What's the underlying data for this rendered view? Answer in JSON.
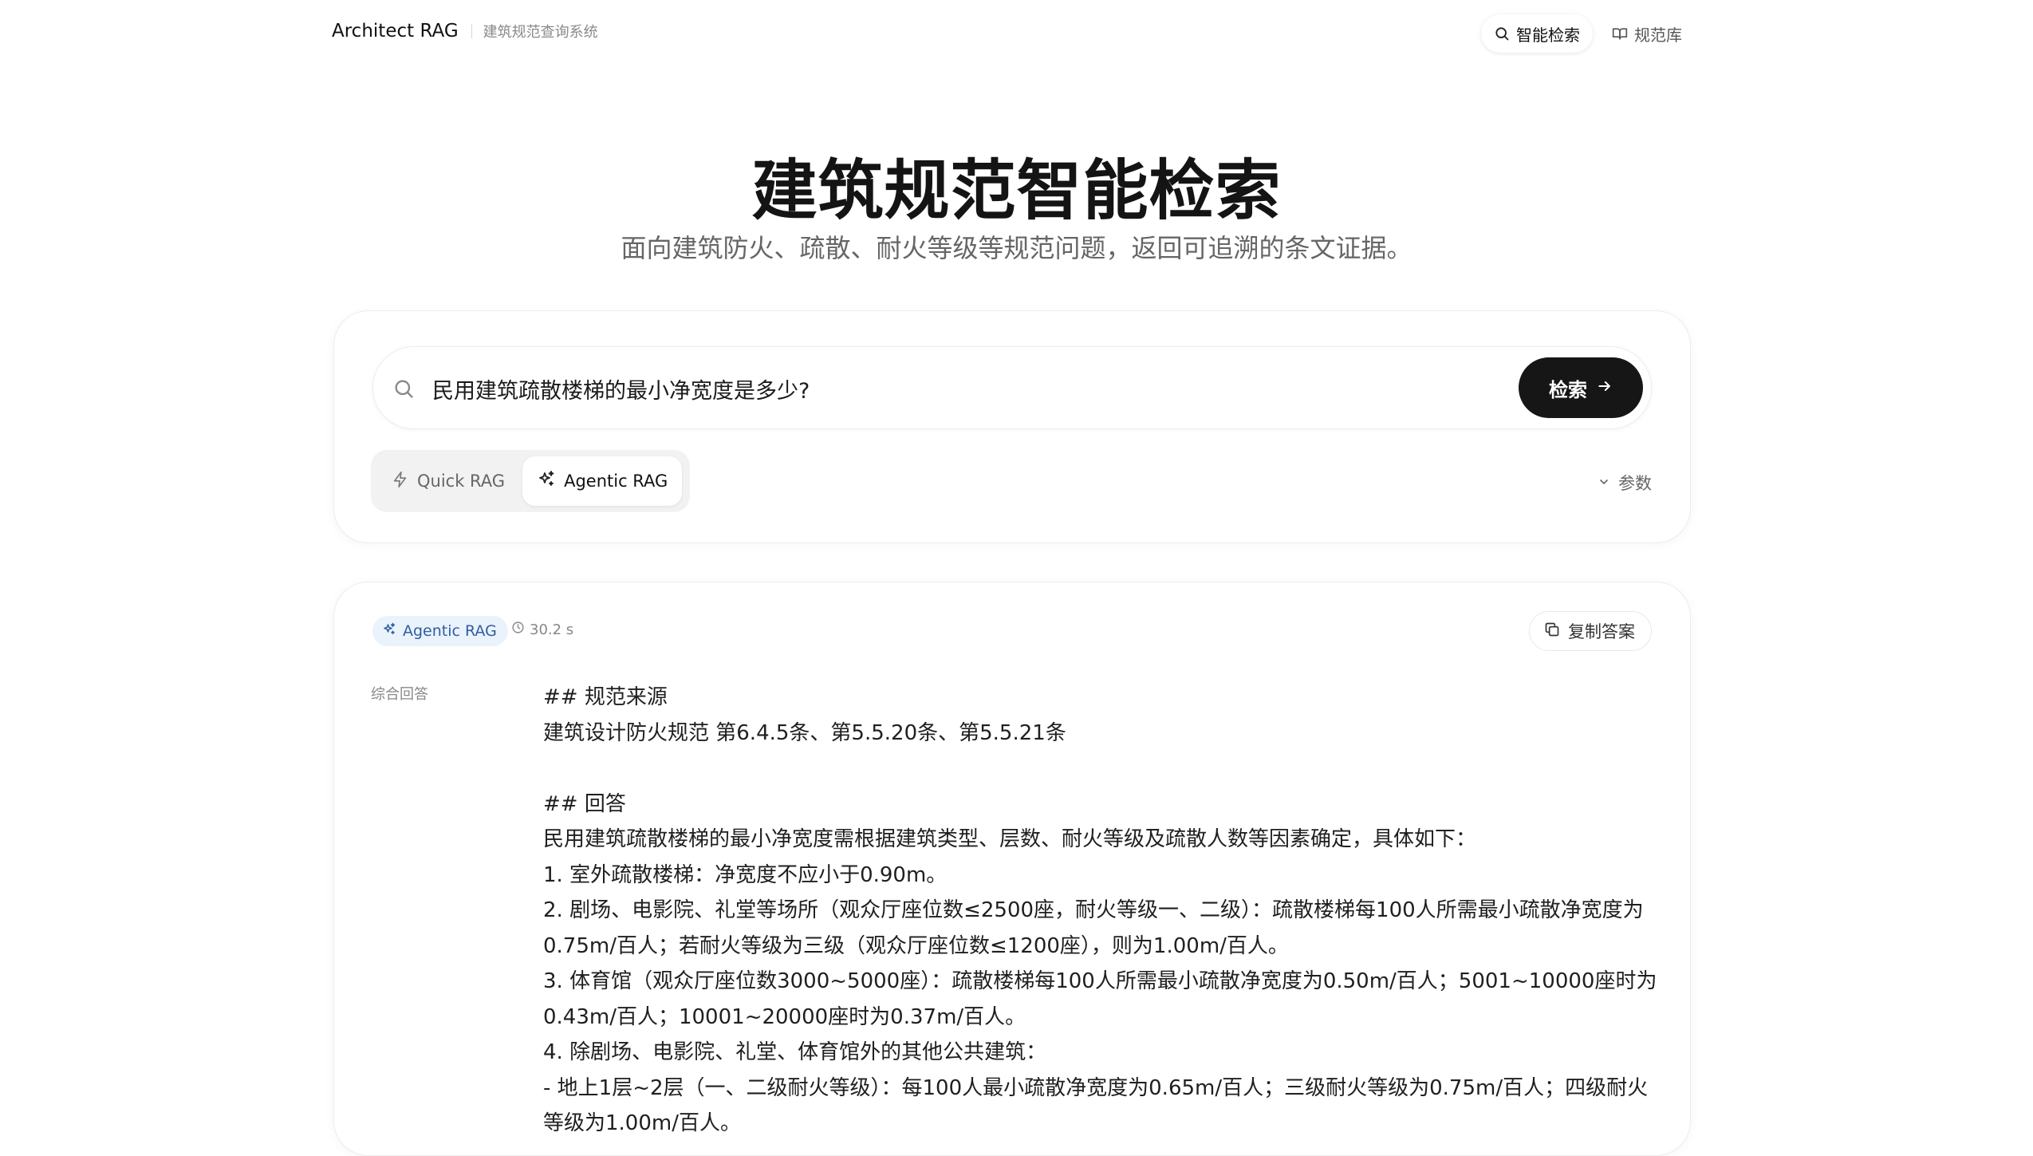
{
  "nav": {
    "brand": "Architect RAG",
    "subtitle": "建筑规范查询系统",
    "links": [
      {
        "label": "智能检索",
        "icon": "search-icon",
        "active": true
      },
      {
        "label": "规范库",
        "icon": "book-icon",
        "active": false
      }
    ]
  },
  "hero": {
    "title": "建筑规范智能检索",
    "subtitle": "面向建筑防火、疏散、耐火等级等规范问题，返回可追溯的条文证据。"
  },
  "search": {
    "value": "民用建筑疏散楼梯的最小净宽度是多少?",
    "button_label": "检索",
    "modes": [
      {
        "label": "Quick RAG",
        "icon": "lightning-icon",
        "active": false
      },
      {
        "label": "Agentic RAG",
        "icon": "sparkles-icon",
        "active": true
      }
    ],
    "params_label": "参数"
  },
  "result": {
    "mode_badge": "Agentic RAG",
    "elapsed": "30.2 s",
    "copy_label": "复制答案",
    "answer_label": "综合回答",
    "answer_lines": [
      "## 规范来源",
      "建筑设计防火规范 第6.4.5条、第5.5.20条、第5.5.21条",
      "",
      "## 回答",
      "民用建筑疏散楼梯的最小净宽度需根据建筑类型、层数、耐火等级及疏散人数等因素确定，具体如下：",
      "1. 室外疏散楼梯：净宽度不应小于0.90m。",
      "2. 剧场、电影院、礼堂等场所（观众厅座位数≤2500座，耐火等级一、二级）：疏散楼梯每100人所需最小疏散净宽度为0.75m/百人；若耐火等级为三级（观众厅座位数≤1200座），则为1.00m/百人。",
      "3. 体育馆（观众厅座位数3000~5000座）：疏散楼梯每100人所需最小疏散净宽度为0.50m/百人；5001~10000座时为0.43m/百人；10001~20000座时为0.37m/百人。",
      "4. 除剧场、电影院、礼堂、体育馆外的其他公共建筑：",
      "   - 地上1层~2层（一、二级耐火等级）：每100人最小疏散净宽度为0.65m/百人；三级耐火等级为0.75m/百人；四级耐火等级为1.00m/百人。"
    ]
  }
}
